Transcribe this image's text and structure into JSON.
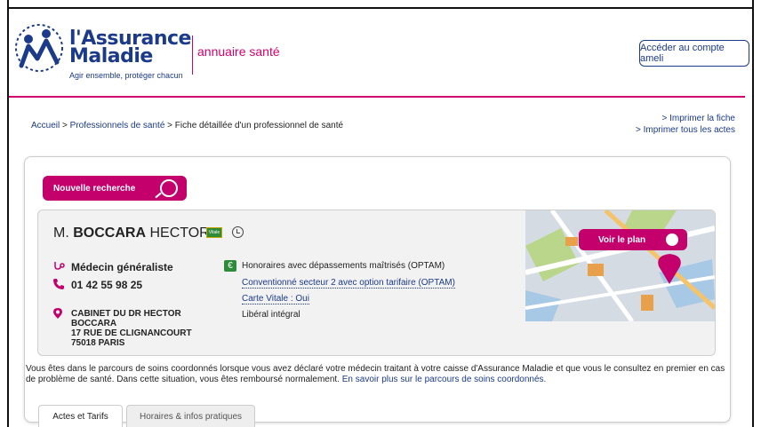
{
  "header": {
    "logo_title_line1": "l'Assurance",
    "logo_title_line2": "Maladie",
    "logo_tagline": "Agir ensemble, protéger chacun",
    "annuaire": "annuaire santé",
    "account_button": "Accéder au compte ameli"
  },
  "breadcrumb": {
    "home": "Accueil",
    "sep1": " > ",
    "professionals": "Professionnels de santé",
    "sep2": " > ",
    "current": "Fiche détaillée d'un professionnel de santé"
  },
  "print_links": {
    "print_sheet": "> Imprimer la fiche",
    "print_acts": "> Imprimer tous les actes"
  },
  "new_search": "Nouvelle recherche",
  "doctor": {
    "title": "M.",
    "last_name": "BOCCARA",
    "first_name": "HECTOR",
    "vitale_badge": "Vitale",
    "specialty": "Médecin généraliste",
    "phone": "01 42 55 98 25",
    "address_line1": "CABINET DU DR HECTOR",
    "address_line2": "BOCCARA",
    "address_line3": "17 RUE DE CLIGNANCOURT",
    "address_line4": "75018 PARIS"
  },
  "tarifs": {
    "honoraires": "Honoraires avec dépassements maîtrisés (OPTAM)",
    "conventionne": "Conventionné secteur 2 avec option tarifaire (OPTAM)",
    "carte_vitale": "Carte Vitale : Oui",
    "liberal": "Libéral intégral"
  },
  "map_button": "Voir le plan",
  "info": {
    "text": "Vous êtes dans le parcours de soins coordonnés lorsque vous avez déclaré votre médecin traitant à votre caisse d'Assurance Maladie et que vous le consultez en premier en cas de problème de santé. Dans cette situation, vous êtes remboursé normalement. ",
    "link": "En savoir plus sur le parcours de soins coordonnés."
  },
  "tabs": {
    "tab1": "Actes et Tarifs",
    "tab2": "Horaires & infos pratiques"
  },
  "colors": {
    "brand_blue": "#1b3a8a",
    "brand_pink": "#c4006c",
    "green": "#2e8b3a"
  },
  "icons": [
    "logo-icon",
    "search-icon",
    "vitale-card-icon",
    "clock-icon",
    "stethoscope-icon",
    "phone-icon",
    "location-pin-icon",
    "euro-icon",
    "map-marker-icon"
  ]
}
